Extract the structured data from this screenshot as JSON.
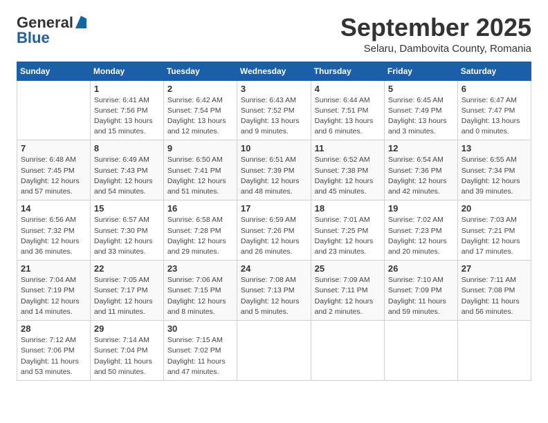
{
  "header": {
    "logo": {
      "line1": "General",
      "line2": "Blue"
    },
    "title": "September 2025",
    "location": "Selaru, Dambovita County, Romania"
  },
  "calendar": {
    "days_of_week": [
      "Sunday",
      "Monday",
      "Tuesday",
      "Wednesday",
      "Thursday",
      "Friday",
      "Saturday"
    ],
    "weeks": [
      [
        {
          "day": "",
          "info": ""
        },
        {
          "day": "1",
          "info": "Sunrise: 6:41 AM\nSunset: 7:56 PM\nDaylight: 13 hours\nand 15 minutes."
        },
        {
          "day": "2",
          "info": "Sunrise: 6:42 AM\nSunset: 7:54 PM\nDaylight: 13 hours\nand 12 minutes."
        },
        {
          "day": "3",
          "info": "Sunrise: 6:43 AM\nSunset: 7:52 PM\nDaylight: 13 hours\nand 9 minutes."
        },
        {
          "day": "4",
          "info": "Sunrise: 6:44 AM\nSunset: 7:51 PM\nDaylight: 13 hours\nand 6 minutes."
        },
        {
          "day": "5",
          "info": "Sunrise: 6:45 AM\nSunset: 7:49 PM\nDaylight: 13 hours\nand 3 minutes."
        },
        {
          "day": "6",
          "info": "Sunrise: 6:47 AM\nSunset: 7:47 PM\nDaylight: 13 hours\nand 0 minutes."
        }
      ],
      [
        {
          "day": "7",
          "info": "Sunrise: 6:48 AM\nSunset: 7:45 PM\nDaylight: 12 hours\nand 57 minutes."
        },
        {
          "day": "8",
          "info": "Sunrise: 6:49 AM\nSunset: 7:43 PM\nDaylight: 12 hours\nand 54 minutes."
        },
        {
          "day": "9",
          "info": "Sunrise: 6:50 AM\nSunset: 7:41 PM\nDaylight: 12 hours\nand 51 minutes."
        },
        {
          "day": "10",
          "info": "Sunrise: 6:51 AM\nSunset: 7:39 PM\nDaylight: 12 hours\nand 48 minutes."
        },
        {
          "day": "11",
          "info": "Sunrise: 6:52 AM\nSunset: 7:38 PM\nDaylight: 12 hours\nand 45 minutes."
        },
        {
          "day": "12",
          "info": "Sunrise: 6:54 AM\nSunset: 7:36 PM\nDaylight: 12 hours\nand 42 minutes."
        },
        {
          "day": "13",
          "info": "Sunrise: 6:55 AM\nSunset: 7:34 PM\nDaylight: 12 hours\nand 39 minutes."
        }
      ],
      [
        {
          "day": "14",
          "info": "Sunrise: 6:56 AM\nSunset: 7:32 PM\nDaylight: 12 hours\nand 36 minutes."
        },
        {
          "day": "15",
          "info": "Sunrise: 6:57 AM\nSunset: 7:30 PM\nDaylight: 12 hours\nand 33 minutes."
        },
        {
          "day": "16",
          "info": "Sunrise: 6:58 AM\nSunset: 7:28 PM\nDaylight: 12 hours\nand 29 minutes."
        },
        {
          "day": "17",
          "info": "Sunrise: 6:59 AM\nSunset: 7:26 PM\nDaylight: 12 hours\nand 26 minutes."
        },
        {
          "day": "18",
          "info": "Sunrise: 7:01 AM\nSunset: 7:25 PM\nDaylight: 12 hours\nand 23 minutes."
        },
        {
          "day": "19",
          "info": "Sunrise: 7:02 AM\nSunset: 7:23 PM\nDaylight: 12 hours\nand 20 minutes."
        },
        {
          "day": "20",
          "info": "Sunrise: 7:03 AM\nSunset: 7:21 PM\nDaylight: 12 hours\nand 17 minutes."
        }
      ],
      [
        {
          "day": "21",
          "info": "Sunrise: 7:04 AM\nSunset: 7:19 PM\nDaylight: 12 hours\nand 14 minutes."
        },
        {
          "day": "22",
          "info": "Sunrise: 7:05 AM\nSunset: 7:17 PM\nDaylight: 12 hours\nand 11 minutes."
        },
        {
          "day": "23",
          "info": "Sunrise: 7:06 AM\nSunset: 7:15 PM\nDaylight: 12 hours\nand 8 minutes."
        },
        {
          "day": "24",
          "info": "Sunrise: 7:08 AM\nSunset: 7:13 PM\nDaylight: 12 hours\nand 5 minutes."
        },
        {
          "day": "25",
          "info": "Sunrise: 7:09 AM\nSunset: 7:11 PM\nDaylight: 12 hours\nand 2 minutes."
        },
        {
          "day": "26",
          "info": "Sunrise: 7:10 AM\nSunset: 7:09 PM\nDaylight: 11 hours\nand 59 minutes."
        },
        {
          "day": "27",
          "info": "Sunrise: 7:11 AM\nSunset: 7:08 PM\nDaylight: 11 hours\nand 56 minutes."
        }
      ],
      [
        {
          "day": "28",
          "info": "Sunrise: 7:12 AM\nSunset: 7:06 PM\nDaylight: 11 hours\nand 53 minutes."
        },
        {
          "day": "29",
          "info": "Sunrise: 7:14 AM\nSunset: 7:04 PM\nDaylight: 11 hours\nand 50 minutes."
        },
        {
          "day": "30",
          "info": "Sunrise: 7:15 AM\nSunset: 7:02 PM\nDaylight: 11 hours\nand 47 minutes."
        },
        {
          "day": "",
          "info": ""
        },
        {
          "day": "",
          "info": ""
        },
        {
          "day": "",
          "info": ""
        },
        {
          "day": "",
          "info": ""
        }
      ]
    ]
  }
}
